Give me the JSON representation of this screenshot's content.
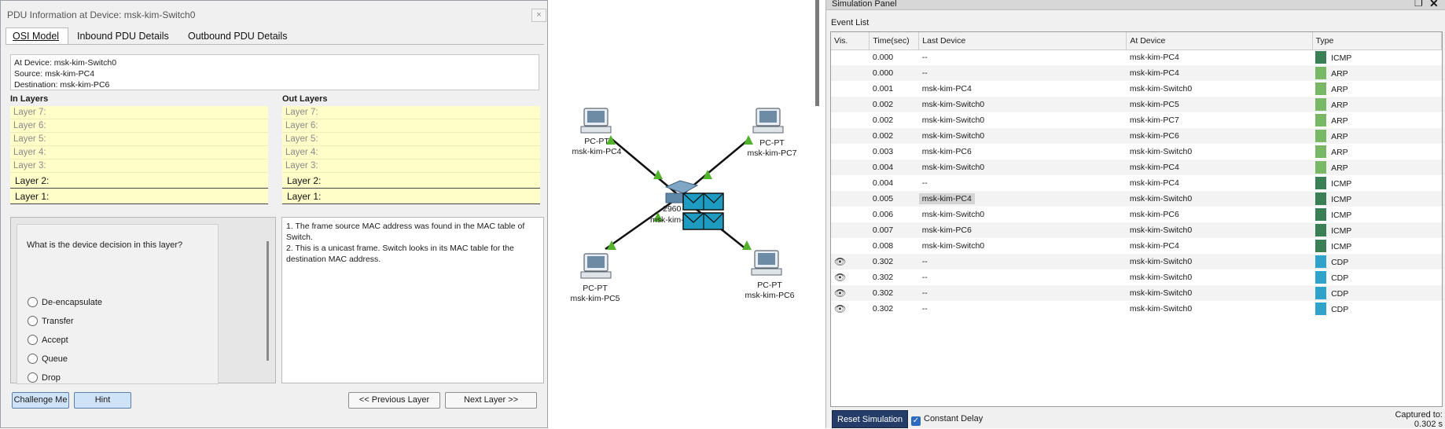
{
  "pdu": {
    "title": "PDU Information at Device: msk-kim-Switch0",
    "close": "×",
    "tabs": [
      "OSI Model",
      "Inbound PDU Details",
      "Outbound PDU Details"
    ],
    "info": {
      "at_device": "At Device: msk-kim-Switch0",
      "source": "Source: msk-kim-PC4",
      "destination": "Destination: msk-kim-PC6"
    },
    "in_layers_title": "In Layers",
    "out_layers_title": "Out Layers",
    "in_layers": [
      "Layer 7:",
      "Layer 6:",
      "Layer 5:",
      "Layer 4:",
      "Layer 3:",
      "Layer 2:",
      "Layer 1:"
    ],
    "out_layers": [
      "Layer 7:",
      "Layer 6:",
      "Layer 5:",
      "Layer 4:",
      "Layer 3:",
      "Layer 2:",
      "Layer 1:"
    ],
    "question": "What is the device decision in this layer?",
    "options": [
      "De-encapsulate",
      "Transfer",
      "Accept",
      "Queue",
      "Drop"
    ],
    "answer_lines": [
      "1. The frame source MAC address was found in the MAC table of Switch.",
      "2. This is a unicast frame. Switch looks in its MAC table for the destination MAC address."
    ],
    "buttons": {
      "challenge": "Challenge Me",
      "hint": "Hint",
      "prev": "<< Previous Layer",
      "next": "Next Layer >>"
    }
  },
  "topology": {
    "devices": [
      {
        "type": "PC-PT",
        "name": "msk-kim-PC4"
      },
      {
        "type": "PC-PT",
        "name": "msk-kim-PC7"
      },
      {
        "type": "PC-PT",
        "name": "msk-kim-PC5"
      },
      {
        "type": "PC-PT",
        "name": "msk-kim-PC6"
      }
    ],
    "switch_label_a": "2960",
    "switch_label_b": "msk-kim-"
  },
  "sim": {
    "title": "Simulation Panel",
    "event_list_label": "Event List",
    "columns": [
      "Vis.",
      "Time(sec)",
      "Last Device",
      "At Device",
      "Type"
    ],
    "events": [
      {
        "vis": "",
        "time": "0.000",
        "last": "--",
        "at": "msk-kim-PC4",
        "type": "ICMP",
        "color": "#3b7f57"
      },
      {
        "vis": "",
        "time": "0.000",
        "last": "--",
        "at": "msk-kim-PC4",
        "type": "ARP",
        "color": "#79b867"
      },
      {
        "vis": "",
        "time": "0.001",
        "last": "msk-kim-PC4",
        "at": "msk-kim-Switch0",
        "type": "ARP",
        "color": "#79b867"
      },
      {
        "vis": "",
        "time": "0.002",
        "last": "msk-kim-Switch0",
        "at": "msk-kim-PC5",
        "type": "ARP",
        "color": "#79b867"
      },
      {
        "vis": "",
        "time": "0.002",
        "last": "msk-kim-Switch0",
        "at": "msk-kim-PC7",
        "type": "ARP",
        "color": "#79b867"
      },
      {
        "vis": "",
        "time": "0.002",
        "last": "msk-kim-Switch0",
        "at": "msk-kim-PC6",
        "type": "ARP",
        "color": "#79b867"
      },
      {
        "vis": "",
        "time": "0.003",
        "last": "msk-kim-PC6",
        "at": "msk-kim-Switch0",
        "type": "ARP",
        "color": "#79b867"
      },
      {
        "vis": "",
        "time": "0.004",
        "last": "msk-kim-Switch0",
        "at": "msk-kim-PC4",
        "type": "ARP",
        "color": "#79b867"
      },
      {
        "vis": "",
        "time": "0.004",
        "last": "--",
        "at": "msk-kim-PC4",
        "type": "ICMP",
        "color": "#3b7f57"
      },
      {
        "vis": "",
        "time": "0.005",
        "last": "msk-kim-PC4",
        "at": "msk-kim-Switch0",
        "type": "ICMP",
        "color": "#3b7f57",
        "highlight": true
      },
      {
        "vis": "",
        "time": "0.006",
        "last": "msk-kim-Switch0",
        "at": "msk-kim-PC6",
        "type": "ICMP",
        "color": "#3b7f57"
      },
      {
        "vis": "",
        "time": "0.007",
        "last": "msk-kim-PC6",
        "at": "msk-kim-Switch0",
        "type": "ICMP",
        "color": "#3b7f57"
      },
      {
        "vis": "",
        "time": "0.008",
        "last": "msk-kim-Switch0",
        "at": "msk-kim-PC4",
        "type": "ICMP",
        "color": "#3b7f57"
      },
      {
        "vis": "eye",
        "time": "0.302",
        "last": "--",
        "at": "msk-kim-Switch0",
        "type": "CDP",
        "color": "#2fa3c9"
      },
      {
        "vis": "eye",
        "time": "0.302",
        "last": "--",
        "at": "msk-kim-Switch0",
        "type": "CDP",
        "color": "#2fa3c9"
      },
      {
        "vis": "eye",
        "time": "0.302",
        "last": "--",
        "at": "msk-kim-Switch0",
        "type": "CDP",
        "color": "#2fa3c9"
      },
      {
        "vis": "eye",
        "time": "0.302",
        "last": "--",
        "at": "msk-kim-Switch0",
        "type": "CDP",
        "color": "#2fa3c9"
      }
    ],
    "reset": "Reset Simulation",
    "constant_delay": "Constant Delay",
    "captured_label": "Captured to:",
    "captured_value": "0.302 s"
  }
}
